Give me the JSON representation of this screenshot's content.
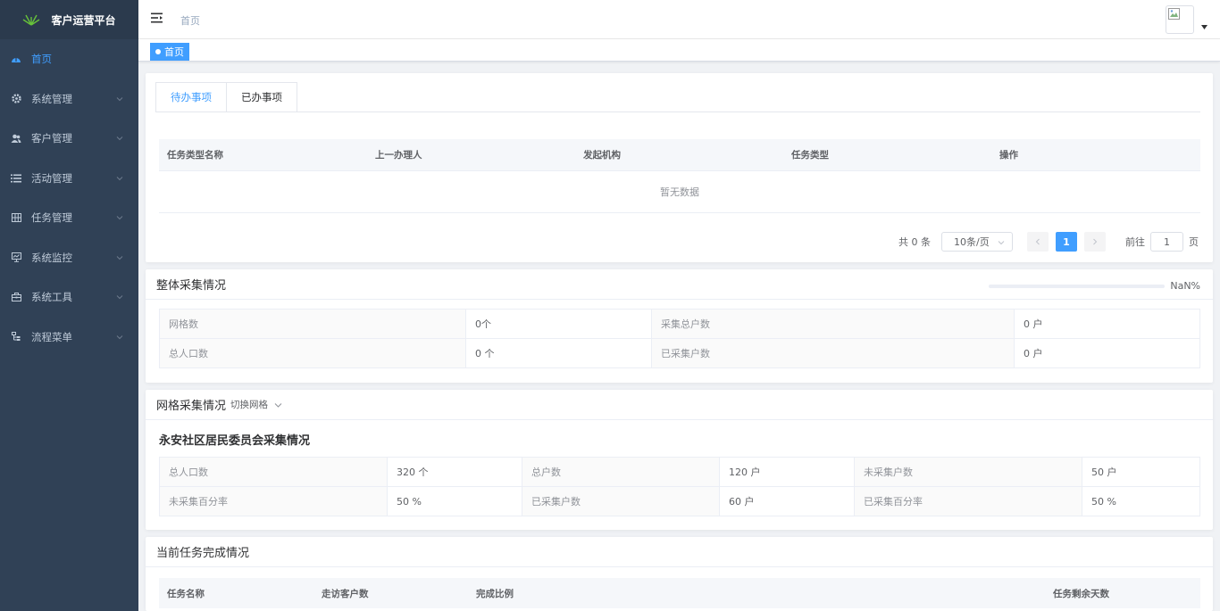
{
  "app": {
    "title": "客户运营平台"
  },
  "sidebar": {
    "items": [
      {
        "label": "首页",
        "icon": "dashboard-icon"
      },
      {
        "label": "系统管理",
        "icon": "gear-icon"
      },
      {
        "label": "客户管理",
        "icon": "users-icon"
      },
      {
        "label": "活动管理",
        "icon": "list-icon"
      },
      {
        "label": "任务管理",
        "icon": "grid-icon"
      },
      {
        "label": "系统监控",
        "icon": "monitor-icon"
      },
      {
        "label": "系统工具",
        "icon": "toolbox-icon"
      },
      {
        "label": "流程菜单",
        "icon": "flow-icon"
      }
    ]
  },
  "navbar": {
    "breadcrumb": "首页"
  },
  "tags": {
    "active": "首页"
  },
  "todo": {
    "tabs": [
      "待办事项",
      "已办事项"
    ],
    "columns": [
      "任务类型名称",
      "上一办理人",
      "发起机构",
      "任务类型",
      "操作"
    ],
    "empty_text": "暂无数据",
    "pagination": {
      "total": "共 0 条",
      "page_size": "10条/页",
      "current_page": "1",
      "goto_label": "前往",
      "goto_value": "1",
      "page_suffix": "页"
    }
  },
  "overall": {
    "title": "整体采集情况",
    "progress_text": "NaN%",
    "rows": [
      {
        "l1": "网格数",
        "v1": "0个",
        "l2": "采集总户数",
        "v2": "0 户"
      },
      {
        "l1": "总人口数",
        "v1": "0 个",
        "l2": "已采集户数",
        "v2": "0 户"
      }
    ]
  },
  "grid": {
    "title": "网格采集情况",
    "switch_label": "切换网格",
    "subtitle": "永安社区居民委员会采集情况",
    "rows": [
      {
        "l1": "总人口数",
        "v1": "320 个",
        "l2": "总户数",
        "v2": "120 户",
        "l3": "未采集户数",
        "v3": "50 户"
      },
      {
        "l1": "未采集百分率",
        "v1": "50 %",
        "l2": "已采集户数",
        "v2": "60 户",
        "l3": "已采集百分率",
        "v3": "50 %"
      }
    ]
  },
  "tasks": {
    "title": "当前任务完成情况",
    "columns": [
      "任务名称",
      "走访客户数",
      "完成比例",
      "任务剩余天数"
    ]
  },
  "colors": {
    "sidebar": "#304156",
    "accent": "#409eff"
  }
}
